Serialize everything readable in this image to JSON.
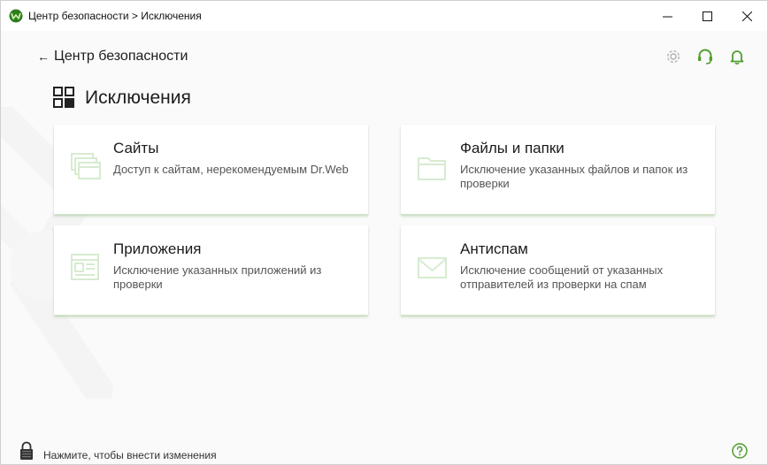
{
  "window": {
    "title": "Центр безопасности > Исключения"
  },
  "header": {
    "back_label": "Центр безопасности",
    "back_arrow": "←"
  },
  "page": {
    "title": "Исключения"
  },
  "cards": [
    {
      "title": "Сайты",
      "description": "Доступ к сайтам, нерекомендуемым Dr.Web",
      "icon": "sites-icon"
    },
    {
      "title": "Файлы и папки",
      "description": "Исключение указанных файлов и папок из проверки",
      "icon": "folder-icon"
    },
    {
      "title": "Приложения",
      "description": "Исключение указанных приложений из проверки",
      "icon": "application-icon"
    },
    {
      "title": "Антиспам",
      "description": "Исключение сообщений от указанных отправителей из проверки на спам",
      "icon": "envelope-icon"
    }
  ],
  "footer": {
    "lock_hint": "Нажмите, чтобы внести изменения"
  },
  "colors": {
    "accent": "#4fa02e",
    "icon_light": "#d7ebd0",
    "gear_gray": "#b0b0b0"
  }
}
